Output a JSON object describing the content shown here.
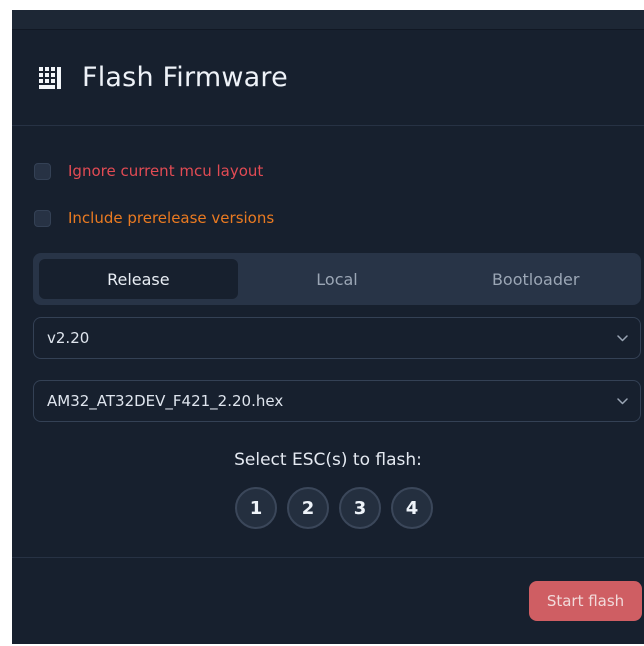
{
  "dialog": {
    "title": "Flash Firmware",
    "icon": "flash-firmware-icon"
  },
  "options": {
    "ignore_layout_label": "Ignore current mcu layout",
    "prerelease_label": "Include prerelease versions"
  },
  "tabs": [
    {
      "label": "Release",
      "active": true
    },
    {
      "label": "Local",
      "active": false
    },
    {
      "label": "Bootloader",
      "active": false
    }
  ],
  "version_select": {
    "value": "v2.20",
    "icon": "chevron-down-icon"
  },
  "file_select": {
    "value": "AM32_AT32DEV_F421_2.20.hex",
    "icon": "chevron-down-icon"
  },
  "esc": {
    "label": "Select ESC(s) to flash:",
    "buttons": [
      "1",
      "2",
      "3",
      "4"
    ]
  },
  "actions": {
    "start_flash": "Start flash"
  },
  "colors": {
    "background": "#17202e",
    "tabs_bg": "#283447",
    "error_text": "#e24b54",
    "warning_text": "#ea7a21",
    "start_button": "#cf5e63"
  }
}
